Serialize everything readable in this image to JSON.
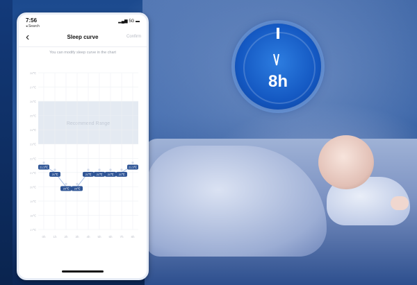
{
  "phone": {
    "status_time": "7:56",
    "status_back_app": "◂ Search",
    "status_signal": "5G",
    "nav_title": "Sleep curve",
    "nav_confirm": "Confirm",
    "hint": "You can modify sleep curve in the chart"
  },
  "chart_data": {
    "type": "line",
    "title": "",
    "band_label": "Recommend Range",
    "y_ticks": [
      "28℃",
      "27℃",
      "26℃",
      "25℃",
      "24℃",
      "23℃",
      "22℃",
      "21℃",
      "20℃",
      "19℃",
      "18℃",
      "17℃"
    ],
    "x": [
      "0h",
      "1h",
      "2h",
      "3h",
      "4h",
      "5h",
      "6h",
      "7h",
      "8h"
    ],
    "series": [
      {
        "values": [
          21.5,
          21,
          20,
          20,
          21,
          21,
          21,
          21,
          21.5
        ]
      }
    ],
    "point_labels": [
      "21.5℃",
      "21℃",
      "20℃",
      "20℃",
      "21℃",
      "21℃",
      "21℃",
      "21℃",
      "21.5℃"
    ],
    "band": [
      23,
      26
    ],
    "ylim": [
      17,
      28
    ],
    "grid": true,
    "colors": {
      "line": "#a9c0e6",
      "marker": "#2f5596",
      "band": "#e4eaf2"
    }
  },
  "badge": {
    "label": "8h"
  }
}
